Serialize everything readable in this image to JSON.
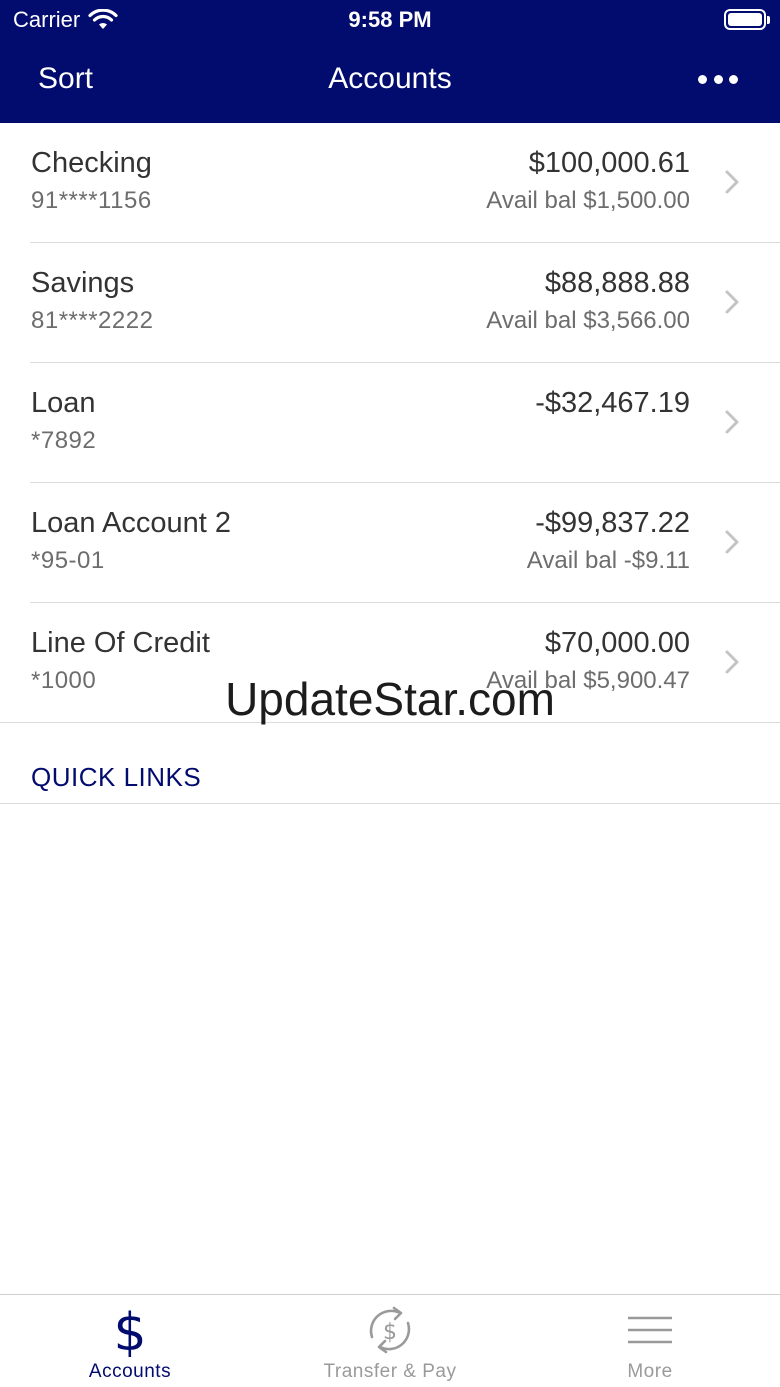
{
  "status_bar": {
    "carrier": "Carrier",
    "time": "9:58 PM"
  },
  "nav": {
    "sort_label": "Sort",
    "title": "Accounts",
    "more_icon": "ellipsis-icon"
  },
  "accounts": [
    {
      "name": "Checking",
      "number": "91****1156",
      "balance": "$100,000.61",
      "available": "Avail bal $1,500.00"
    },
    {
      "name": "Savings",
      "number": "81****2222",
      "balance": "$88,888.88",
      "available": "Avail bal $3,566.00"
    },
    {
      "name": "Loan",
      "number": "*7892",
      "balance": "-$32,467.19",
      "available": ""
    },
    {
      "name": "Loan Account 2",
      "number": "*95-01",
      "balance": "-$99,837.22",
      "available": "Avail bal -$9.11"
    },
    {
      "name": "Line Of Credit",
      "number": "*1000",
      "balance": "$70,000.00",
      "available": "Avail bal $5,900.47"
    }
  ],
  "quick_links_label": "QUICK LINKS",
  "watermark": "UpdateStar.com",
  "tab_bar": {
    "tabs": [
      {
        "label": "Accounts",
        "icon": "dollar-icon",
        "active": true
      },
      {
        "label": "Transfer & Pay",
        "icon": "transfer-icon",
        "active": false
      },
      {
        "label": "More",
        "icon": "menu-icon",
        "active": false
      }
    ]
  },
  "colors": {
    "brand": "#020b6e",
    "inactive_tab": "#9a9a9a",
    "divider": "#dcdcdc"
  }
}
